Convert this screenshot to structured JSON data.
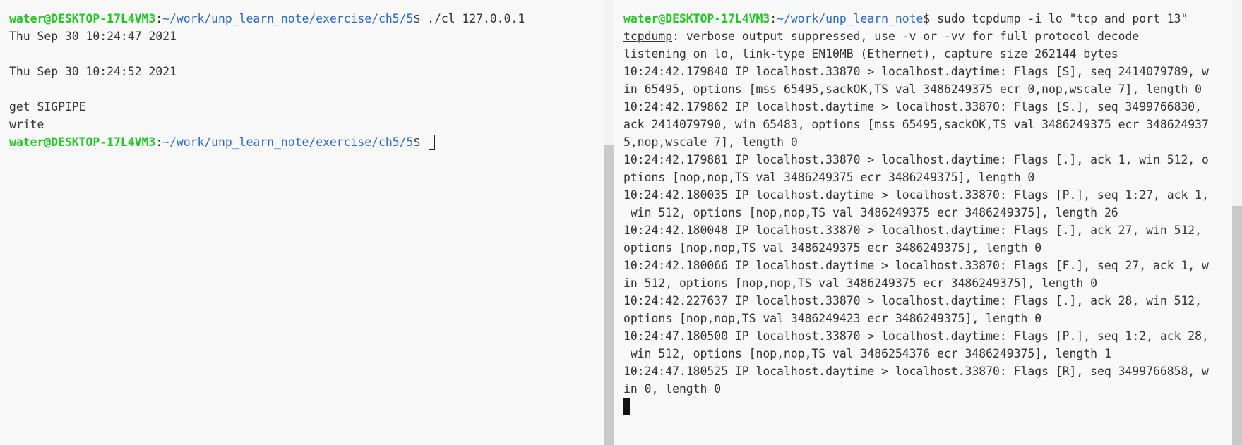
{
  "left_terminal": {
    "prompt": {
      "user": "water@DESKTOP-17L4VM3",
      "colon": ":",
      "path": "~/work/unp_learn_note/exercise/ch5/5",
      "dollar": "$ "
    },
    "command": "./cl 127.0.0.1",
    "output": [
      "Thu Sep 30 10:24:47 2021",
      "",
      "Thu Sep 30 10:24:52 2021",
      "",
      "get SIGPIPE",
      "write"
    ]
  },
  "right_terminal": {
    "prompt": {
      "user": "water@DESKTOP-17L4VM3",
      "colon": ":",
      "path": "~/work/unp_learn_note",
      "dollar": "$ "
    },
    "command": "sudo tcpdump -i lo \"tcp and port 13\"",
    "tcpdump_word": "tcpdump",
    "tcpdump_rest": ": verbose output suppressed, use -v or -vv for full protocol decode",
    "output": [
      "listening on lo, link-type EN10MB (Ethernet), capture size 262144 bytes",
      "10:24:42.179840 IP localhost.33870 > localhost.daytime: Flags [S], seq 2414079789, w",
      "in 65495, options [mss 65495,sackOK,TS val 3486249375 ecr 0,nop,wscale 7], length 0",
      "10:24:42.179862 IP localhost.daytime > localhost.33870: Flags [S.], seq 3499766830,",
      "ack 2414079790, win 65483, options [mss 65495,sackOK,TS val 3486249375 ecr 348624937",
      "5,nop,wscale 7], length 0",
      "10:24:42.179881 IP localhost.33870 > localhost.daytime: Flags [.], ack 1, win 512, o",
      "ptions [nop,nop,TS val 3486249375 ecr 3486249375], length 0",
      "10:24:42.180035 IP localhost.daytime > localhost.33870: Flags [P.], seq 1:27, ack 1,",
      " win 512, options [nop,nop,TS val 3486249375 ecr 3486249375], length 26",
      "10:24:42.180048 IP localhost.33870 > localhost.daytime: Flags [.], ack 27, win 512,",
      "options [nop,nop,TS val 3486249375 ecr 3486249375], length 0",
      "10:24:42.180066 IP localhost.daytime > localhost.33870: Flags [F.], seq 27, ack 1, w",
      "in 512, options [nop,nop,TS val 3486249375 ecr 3486249375], length 0",
      "10:24:42.227637 IP localhost.33870 > localhost.daytime: Flags [.], ack 28, win 512,",
      "options [nop,nop,TS val 3486249423 ecr 3486249375], length 0",
      "10:24:47.180500 IP localhost.33870 > localhost.daytime: Flags [P.], seq 1:2, ack 28,",
      " win 512, options [nop,nop,TS val 3486254376 ecr 3486249375], length 1",
      "10:24:47.180525 IP localhost.daytime > localhost.33870: Flags [R], seq 3499766858, w",
      "in 0, length 0"
    ]
  },
  "colors": {
    "user": "#27c429",
    "path": "#2a6ac8",
    "text": "#333333",
    "background": "#f8f8f8"
  }
}
